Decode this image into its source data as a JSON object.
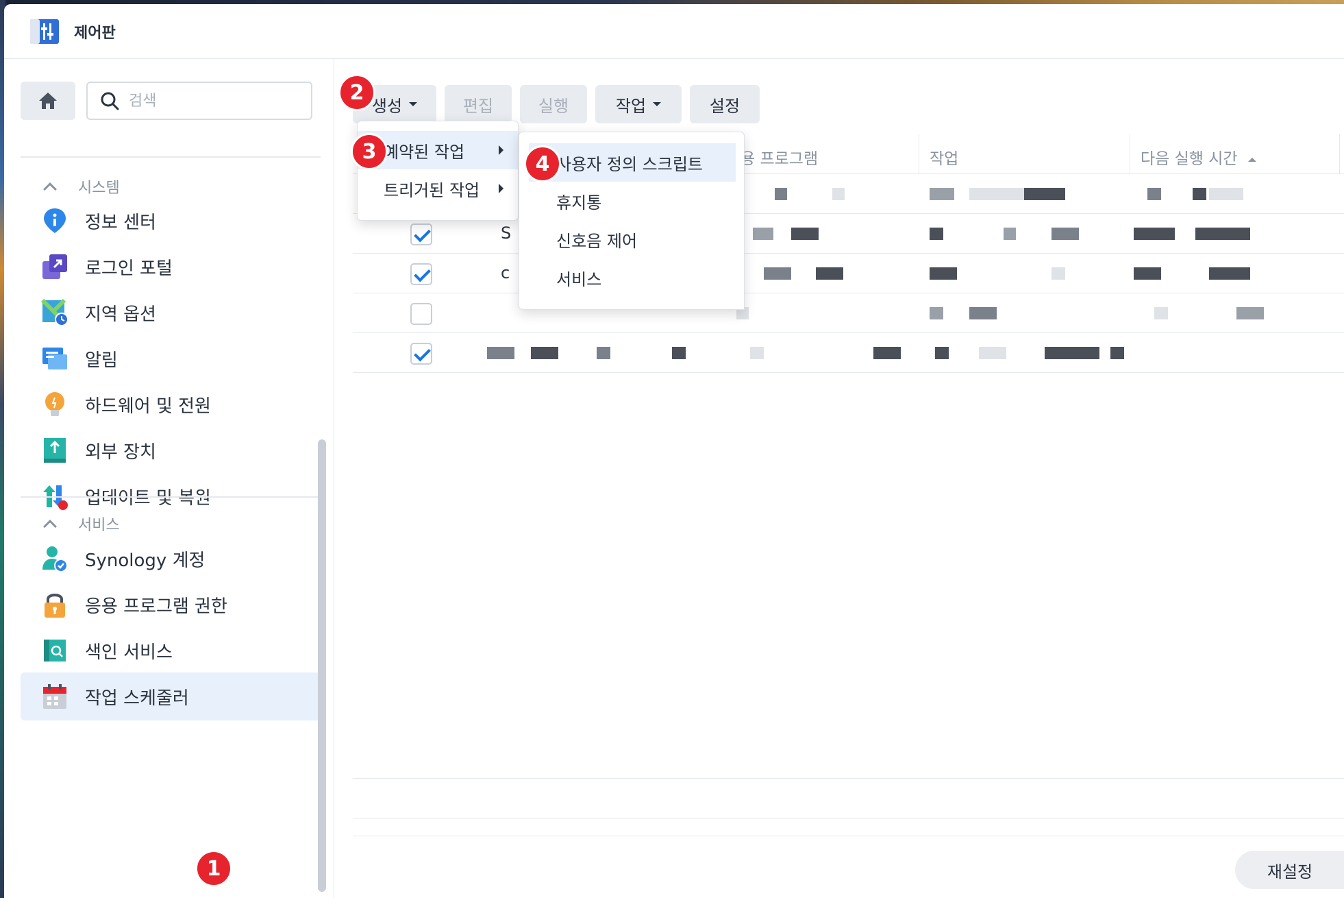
{
  "window": {
    "title": "제어판"
  },
  "sidebar": {
    "search_placeholder": "검색",
    "sections": [
      {
        "label": "시스템"
      },
      {
        "label": "서비스"
      }
    ],
    "items": [
      {
        "label": "정보 센터",
        "icon": "info-icon"
      },
      {
        "label": "로그인 포털",
        "icon": "login-portal-icon"
      },
      {
        "label": "지역 옵션",
        "icon": "regional-options-icon"
      },
      {
        "label": "알림",
        "icon": "notification-icon"
      },
      {
        "label": "하드웨어 및 전원",
        "icon": "hardware-power-icon"
      },
      {
        "label": "외부 장치",
        "icon": "external-device-icon"
      },
      {
        "label": "업데이트 및 복원",
        "icon": "update-restore-icon"
      },
      {
        "label": "Synology 계정",
        "icon": "synology-account-icon"
      },
      {
        "label": "응용 프로그램 권한",
        "icon": "app-privileges-icon"
      },
      {
        "label": "색인 서비스",
        "icon": "indexing-service-icon"
      },
      {
        "label": "작업 스케줄러",
        "icon": "task-scheduler-icon",
        "active": true
      }
    ]
  },
  "toolbar": {
    "create": "생성",
    "edit": "편집",
    "run": "실행",
    "action": "작업",
    "settings": "설정"
  },
  "table": {
    "columns": [
      "용 프로그램",
      "작업",
      "다음 실행 시간"
    ],
    "rows": [
      {
        "checked": true,
        "text": ""
      },
      {
        "checked": true,
        "text": "S"
      },
      {
        "checked": true,
        "text": "c"
      },
      {
        "checked": false,
        "text": ""
      },
      {
        "checked": true,
        "text": ""
      }
    ]
  },
  "create_menu": {
    "items": [
      {
        "label": "예약된 작업"
      },
      {
        "label": "트리거된 작업"
      }
    ]
  },
  "submenu": {
    "items": [
      {
        "label": "사용자 정의 스크립트"
      },
      {
        "label": "휴지통"
      },
      {
        "label": "신호음 제어"
      },
      {
        "label": "서비스"
      }
    ]
  },
  "footer": {
    "reset": "재설정"
  },
  "badges": [
    "1",
    "2",
    "3",
    "4"
  ],
  "colors": {
    "accent": "#1677e3",
    "badge": "#e7242d",
    "active_bg": "#e7f0fb"
  }
}
